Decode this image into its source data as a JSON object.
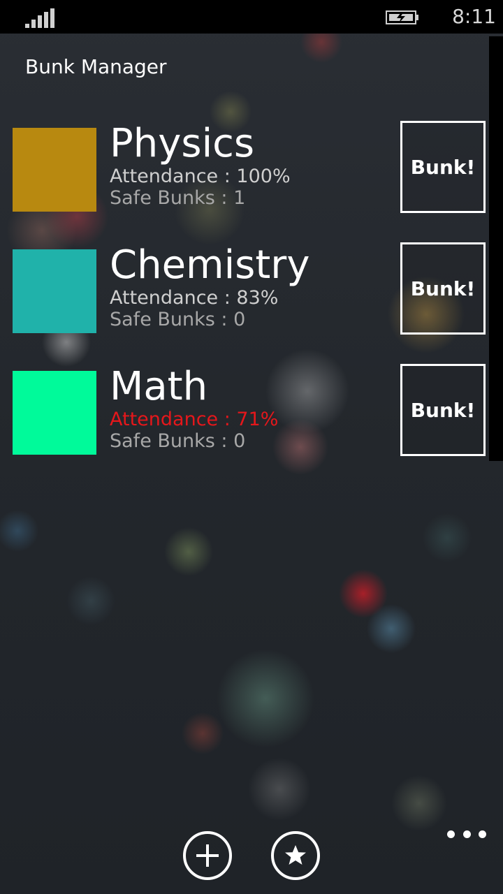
{
  "status_bar": {
    "time": "8:11",
    "signal_icon": "signal-bars-icon",
    "battery_icon": "battery-charging-icon"
  },
  "app": {
    "title": "Bunk Manager"
  },
  "subjects": [
    {
      "name": "Physics",
      "color": "#b88910",
      "attendance": "Attendance : 100%",
      "safe_bunks": "Safe Bunks : 1",
      "bunk_label": "Bunk!",
      "low": false
    },
    {
      "name": "Chemistry",
      "color": "#20b2aa",
      "attendance": "Attendance : 83%",
      "safe_bunks": "Safe Bunks : 0",
      "bunk_label": "Bunk!",
      "low": false
    },
    {
      "name": "Math",
      "color": "#00fa9a",
      "attendance": "Attendance : 71%",
      "safe_bunks": "Safe Bunks : 0",
      "bunk_label": "Bunk!",
      "low": true
    }
  ],
  "colors": {
    "low_attendance": "#e5171b",
    "background": "#23272c"
  },
  "app_bar": {
    "add_icon": "add-icon",
    "favorite_icon": "star-icon",
    "more_icon": "ellipsis-icon"
  }
}
